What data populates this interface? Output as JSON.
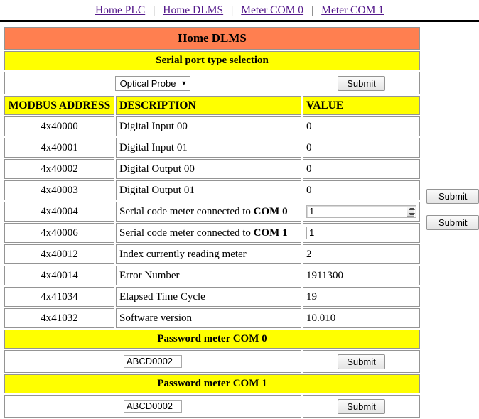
{
  "nav": {
    "separator": "|",
    "links": [
      {
        "label": "Home PLC"
      },
      {
        "label": "Home DLMS"
      },
      {
        "label": "Meter COM 0"
      },
      {
        "label": "Meter COM 1"
      }
    ]
  },
  "page": {
    "title": "Home DLMS",
    "serial_section_title": "Serial port type selection",
    "password_com0_title": "Password meter COM 0",
    "password_com1_title": "Password meter COM 1"
  },
  "serial_select": {
    "selected": "Optical Probe",
    "caret": "▼",
    "options": [
      "Optical Probe"
    ],
    "submit_label": "Submit"
  },
  "table": {
    "headers": {
      "address": "MODBUS ADDRESS",
      "description": "DESCRIPTION",
      "value": "VALUE"
    },
    "rows": [
      {
        "address": "4x40000",
        "description": "Digital Input 00",
        "value": "0",
        "type": "text"
      },
      {
        "address": "4x40001",
        "description": "Digital Input 01",
        "value": "0",
        "type": "text"
      },
      {
        "address": "4x40002",
        "description": "Digital Output 00",
        "value": "0",
        "type": "text"
      },
      {
        "address": "4x40003",
        "description": "Digital Output 01",
        "value": "0",
        "type": "text"
      },
      {
        "address": "4x40004",
        "description_prefix": "Serial code meter connected to ",
        "description_strong": "COM 0",
        "value": "1",
        "type": "number-input",
        "submit_label": "Submit"
      },
      {
        "address": "4x40006",
        "description_prefix": "Serial code meter connected to ",
        "description_strong": "COM 1",
        "value": "1",
        "type": "input",
        "submit_label": "Submit"
      },
      {
        "address": "4x40012",
        "description": "Index currently reading meter",
        "value": "2",
        "type": "text"
      },
      {
        "address": "4x40014",
        "description": "Error Number",
        "value": "1911300",
        "type": "text"
      },
      {
        "address": "4x41034",
        "description": "Elapsed Time Cycle",
        "value": "19",
        "type": "text"
      },
      {
        "address": "4x41032",
        "description": "Software version",
        "value": "10.010",
        "type": "text"
      }
    ]
  },
  "password_com0": {
    "value": "ABCD0002",
    "submit_label": "Submit"
  },
  "password_com1": {
    "value": "ABCD0002",
    "submit_label": "Submit"
  },
  "colors": {
    "title_bar": "#ff7f50",
    "band": "#ffff00",
    "link": "#551a8b"
  }
}
